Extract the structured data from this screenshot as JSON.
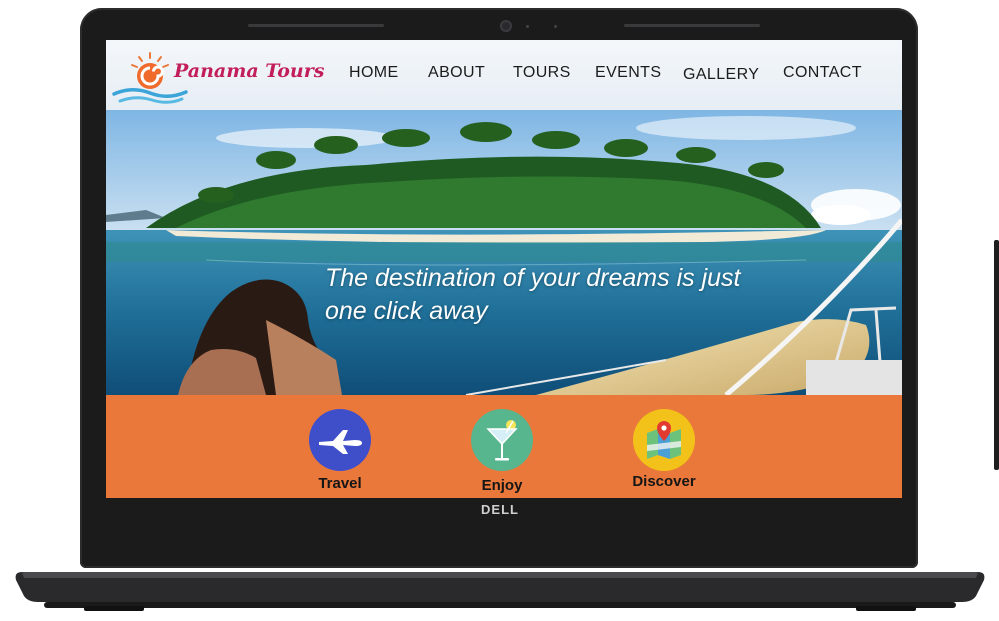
{
  "site": {
    "brand_name": "Panama Tours",
    "logo_icon": "sun-wave-logo-icon"
  },
  "nav": {
    "items": [
      {
        "label": "HOME"
      },
      {
        "label": "ABOUT"
      },
      {
        "label": "TOURS"
      },
      {
        "label": "EVENTS"
      },
      {
        "label": "GALLERY"
      },
      {
        "label": "CONTACT"
      }
    ]
  },
  "hero": {
    "headline_line1": "The destination of your dreams is just",
    "headline_line2": "one click away",
    "image": "tropical-island-beach-woman-boat-image"
  },
  "features": {
    "items": [
      {
        "label": "Travel",
        "icon": "airplane-icon",
        "color": "#3f4fc9"
      },
      {
        "label": "Enjoy",
        "icon": "cocktail-icon",
        "color": "#58b68f"
      },
      {
        "label": "Discover",
        "icon": "map-pin-icon",
        "color": "#f3c21a"
      }
    ],
    "background_color": "#e9783a"
  },
  "device": {
    "brand": "DELL"
  }
}
